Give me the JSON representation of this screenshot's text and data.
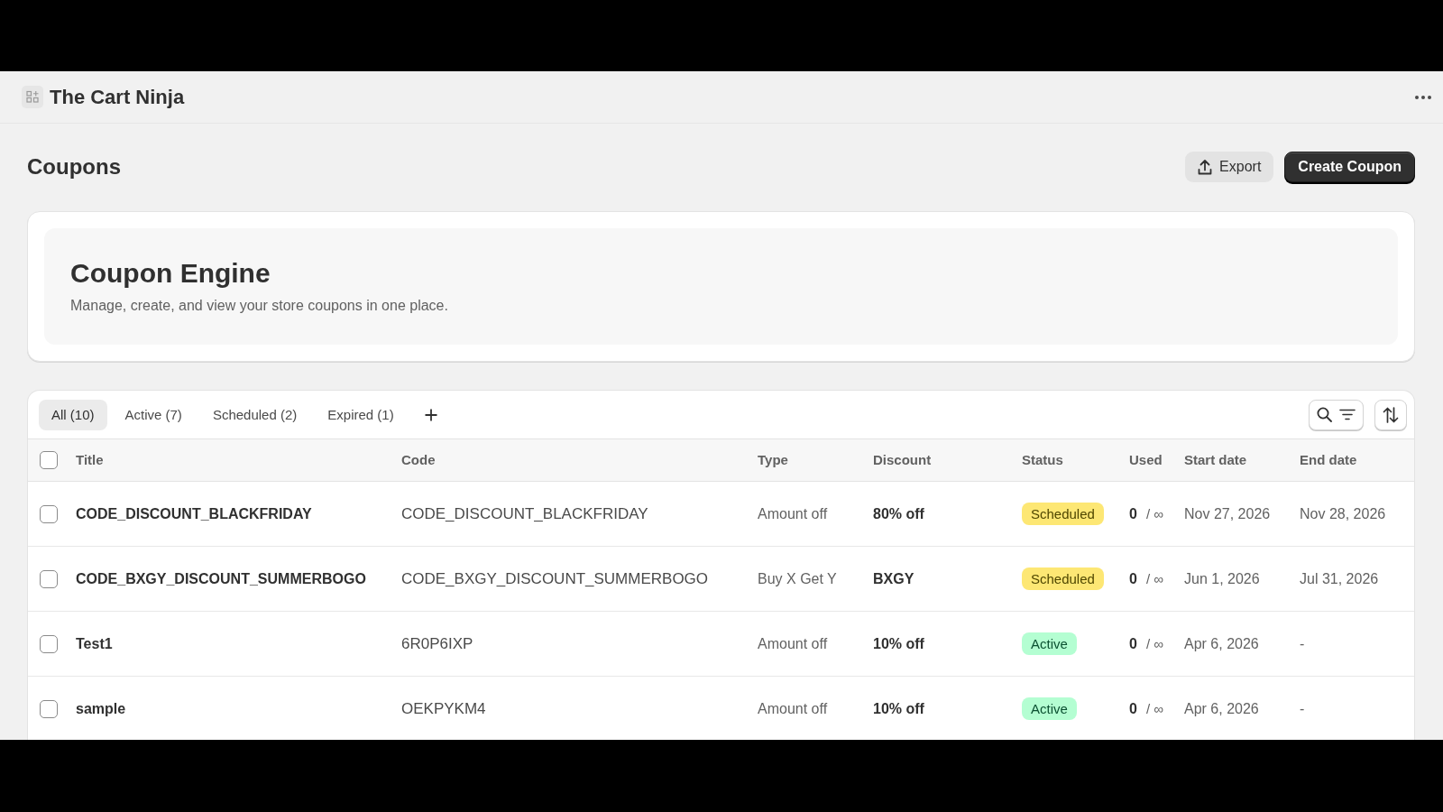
{
  "app": {
    "title": "The Cart Ninja"
  },
  "page": {
    "title": "Coupons",
    "actions": [
      {
        "label": "Export",
        "kind": "secondary"
      },
      {
        "label": "Create Coupon",
        "kind": "primary"
      }
    ]
  },
  "banner": {
    "title": "Coupon Engine",
    "subtitle": "Manage, create, and view your store coupons in one place."
  },
  "coupons": {
    "tabs": [
      {
        "label": "All (10)",
        "selected": true
      },
      {
        "label": "Active (7)",
        "selected": false
      },
      {
        "label": "Scheduled (2)",
        "selected": false
      },
      {
        "label": "Expired (1)",
        "selected": false
      }
    ],
    "table": {
      "select_all": {
        "checked": false
      },
      "columns": [
        "Title",
        "Code",
        "Type",
        "Discount",
        "Status",
        "Used",
        "Start date",
        "End date"
      ],
      "rows": [
        {
          "checked": false,
          "title": "CODE_DISCOUNT_BLACKFRIDAY",
          "code": "CODE_DISCOUNT_BLACKFRIDAY",
          "type": "Amount off",
          "discount": "80% off",
          "status": {
            "label": "Scheduled",
            "kind": "scheduled"
          },
          "used": "0",
          "limit": "/ ∞",
          "start_date": "Nov 27, 2026",
          "end_date": "Nov 28, 2026"
        },
        {
          "checked": false,
          "title": "CODE_BXGY_DISCOUNT_SUMMERBOGO",
          "code": "CODE_BXGY_DISCOUNT_SUMMERBOGO",
          "type": "Buy X Get Y",
          "discount": "BXGY",
          "status": {
            "label": "Scheduled",
            "kind": "scheduled"
          },
          "used": "0",
          "limit": "/ ∞",
          "start_date": "Jun 1, 2026",
          "end_date": "Jul 31, 2026"
        },
        {
          "checked": false,
          "title": "Test1",
          "code": "6R0P6IXP",
          "type": "Amount off",
          "discount": "10% off",
          "status": {
            "label": "Active",
            "kind": "active"
          },
          "used": "0",
          "limit": "/ ∞",
          "start_date": "Apr 6, 2026",
          "end_date": "-"
        },
        {
          "checked": false,
          "title": "sample",
          "code": "OEKPYKM4",
          "type": "Amount off",
          "discount": "10% off",
          "status": {
            "label": "Active",
            "kind": "active"
          },
          "used": "0",
          "limit": "/ ∞",
          "start_date": "Apr 6, 2026",
          "end_date": "-"
        }
      ]
    }
  }
}
